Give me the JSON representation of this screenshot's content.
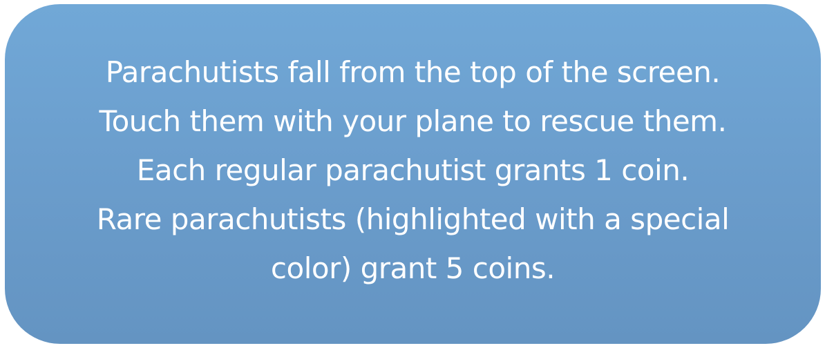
{
  "instructions": {
    "lines": [
      "Parachutists fall from the top of the screen.",
      "Touch them with your plane to rescue them.",
      "Each regular parachutist grants 1 coin.",
      "Rare parachutists (highlighted with a special",
      "color) grant 5 coins."
    ]
  },
  "colors": {
    "panel_top": "#71a8d7",
    "panel_bottom": "#6494c2",
    "text": "#ffffff"
  }
}
